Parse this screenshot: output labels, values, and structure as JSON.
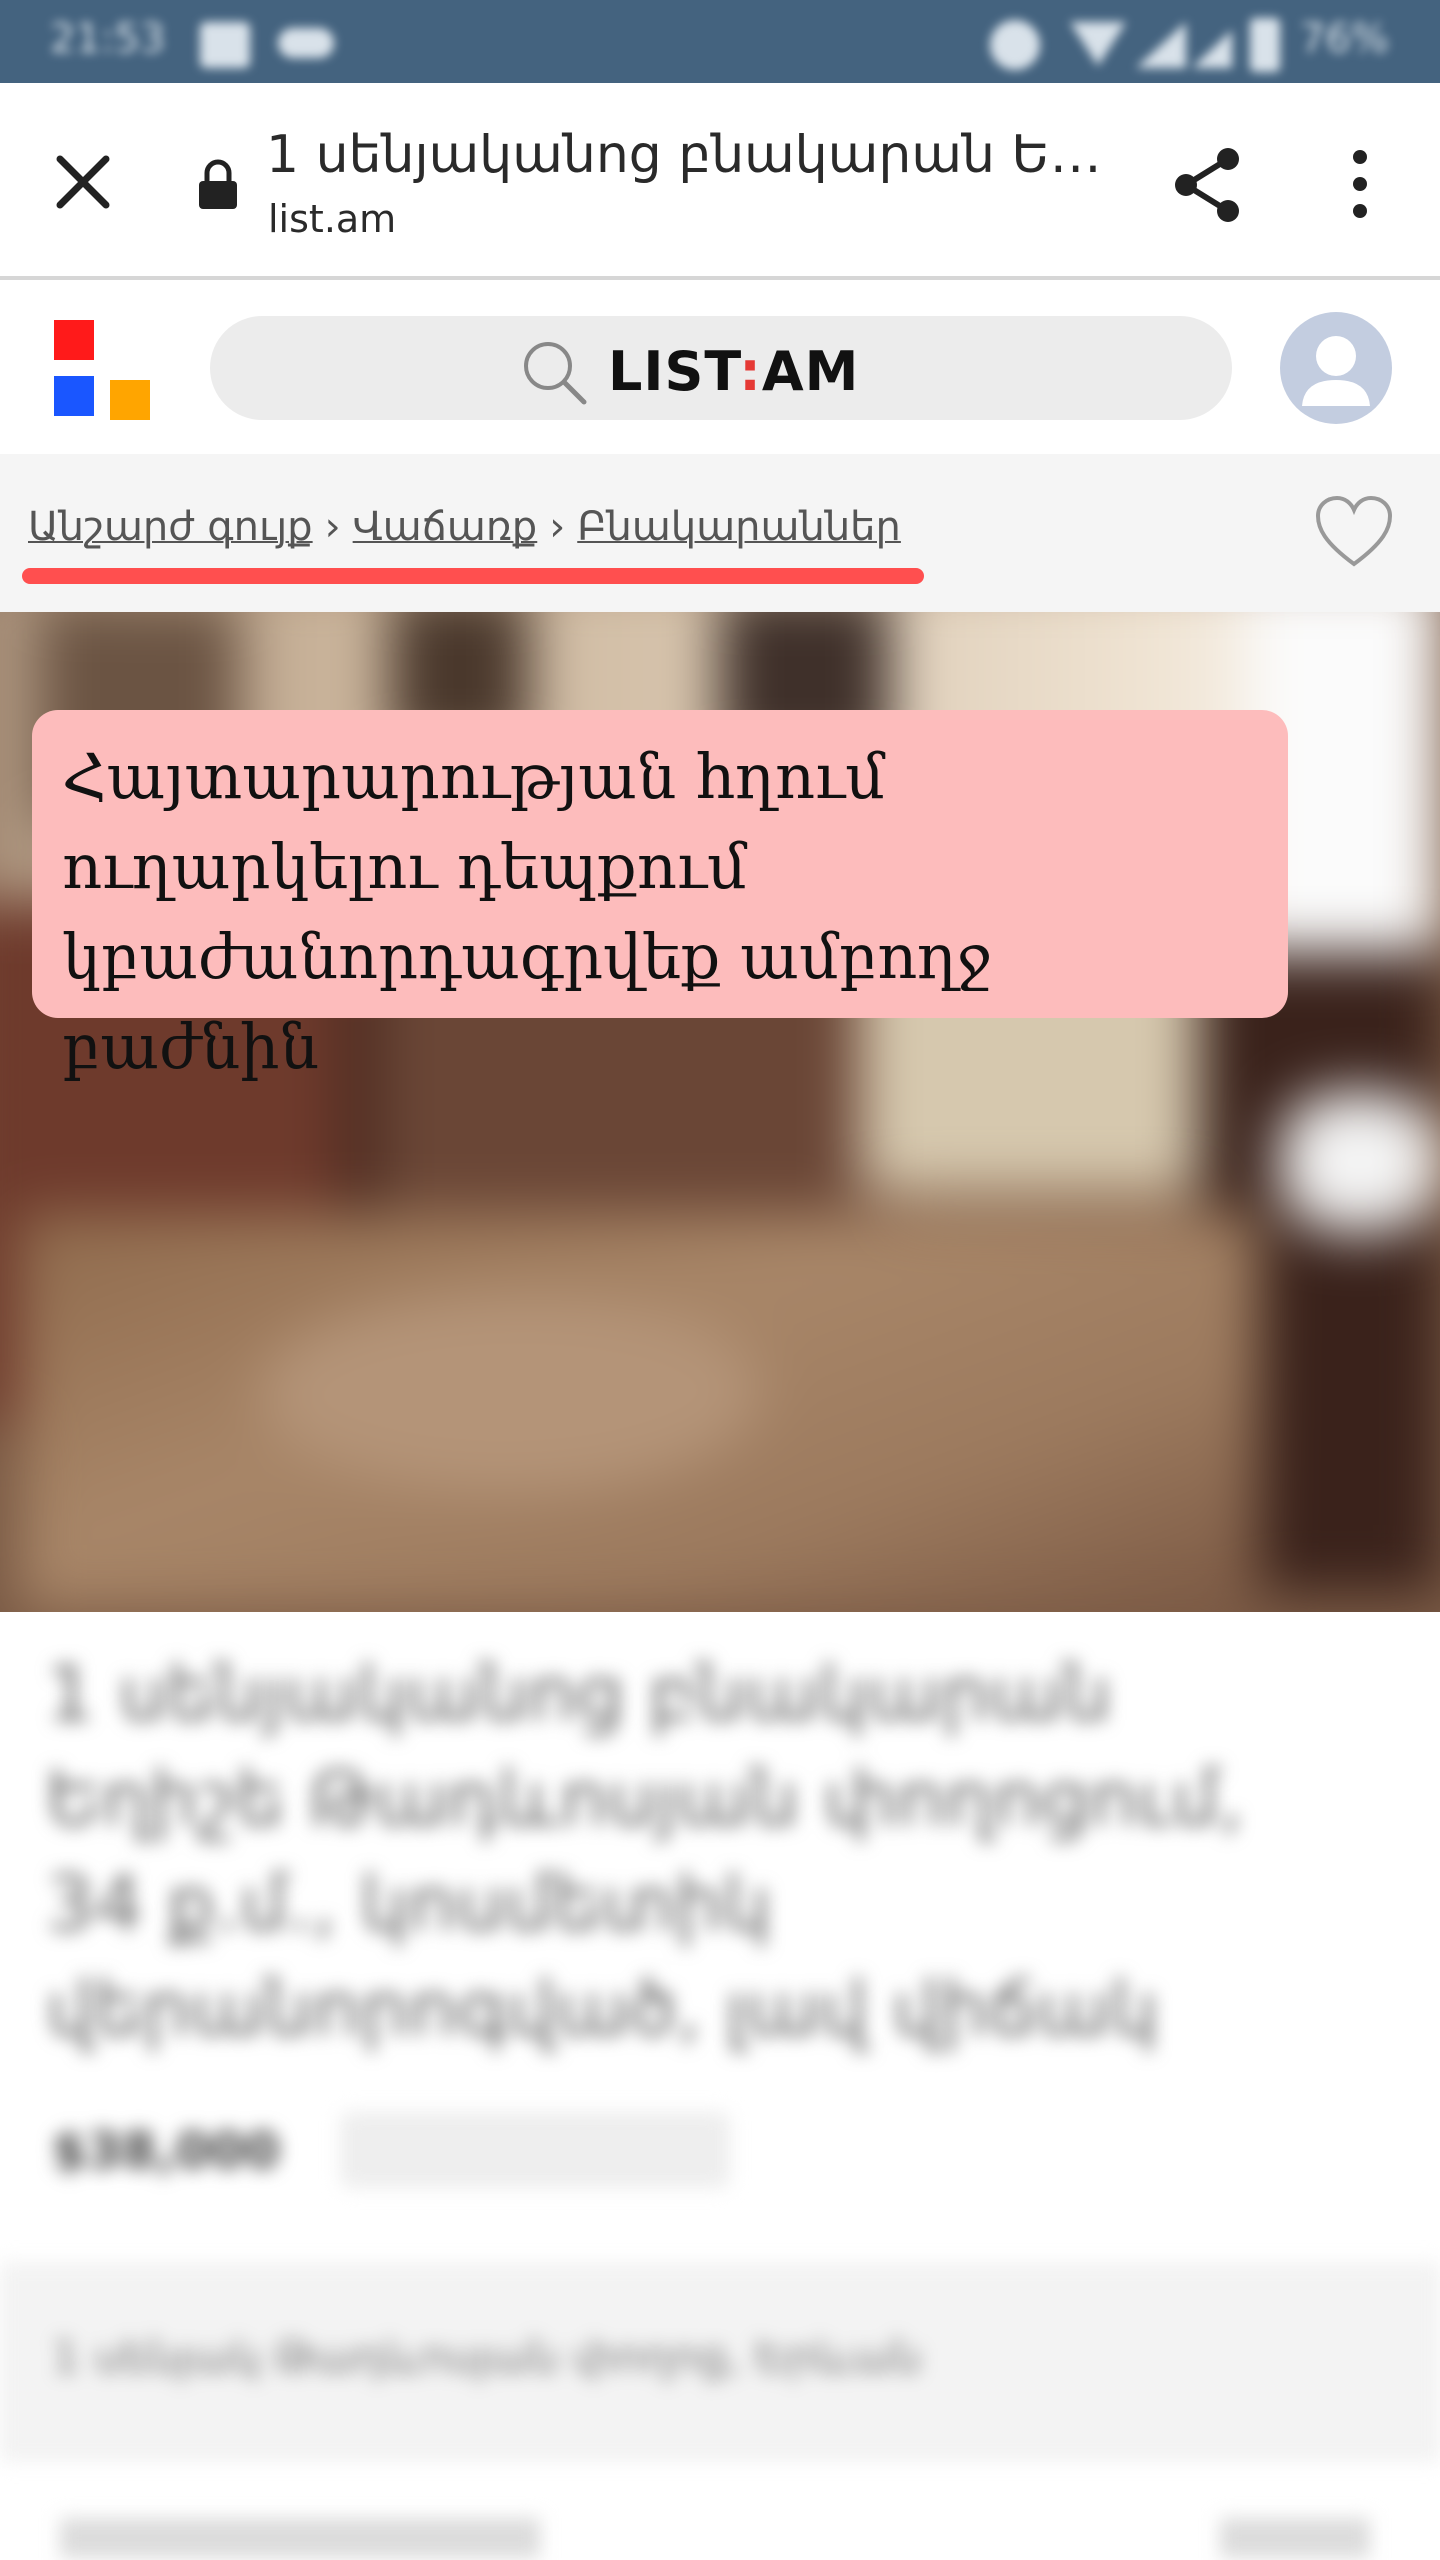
{
  "status_bar": {
    "time": "21:53",
    "battery": "76%"
  },
  "browser": {
    "title": "1 սենյականոց բնակարան Ե…",
    "url": "list.am",
    "icons": {
      "close": "close-icon",
      "lock": "lock-icon",
      "share": "share-icon",
      "menu": "more-vert-icon"
    }
  },
  "header": {
    "brand_left": "LIST",
    "brand_sep": ":",
    "brand_right": "AM",
    "logo_colors": [
      "#ff1a1a",
      "#1a56ff",
      "#ffa500"
    ],
    "icons": {
      "search": "search-icon",
      "avatar": "user-avatar-icon"
    }
  },
  "breadcrumb": {
    "items": [
      "Անշարժ գույք",
      "Վաճառք",
      "Բնակարաններ"
    ],
    "separator": "›",
    "highlight_color": "#ff4f4f"
  },
  "notice": {
    "text": "Հայտարարության հղում ուղարկելու դեպքում կբաժանորդագրվեք ամբողջ բաժնին",
    "background": "#fdbcbc"
  },
  "listing": {
    "title": "1 սենյականոց բնակարան Եղիշե Թադևոսյան փողոցում, 34 ք.մ., կոսմետիկ վերանորոգված, լավ վիճակ",
    "price": "$38,000",
    "meta": "1 սենյակ Թադևոսյան փողոց, Երևան"
  }
}
